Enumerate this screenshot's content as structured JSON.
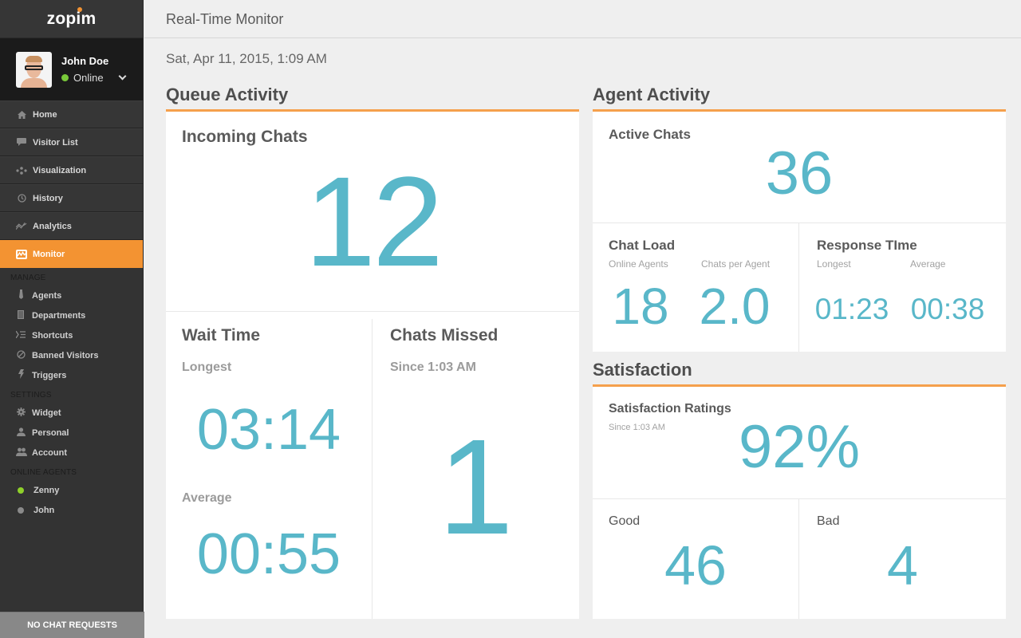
{
  "app": {
    "logo": "zopim",
    "page_title": "Real-Time Monitor",
    "datetime": "Sat, Apr 11, 2015, 1:09 AM"
  },
  "user": {
    "name": "John Doe",
    "status": "Online"
  },
  "nav": {
    "items": [
      {
        "label": "Home",
        "icon": "home-icon"
      },
      {
        "label": "Visitor List",
        "icon": "chat-bubble-icon"
      },
      {
        "label": "Visualization",
        "icon": "visualization-icon"
      },
      {
        "label": "History",
        "icon": "clock-icon"
      },
      {
        "label": "Analytics",
        "icon": "analytics-icon"
      },
      {
        "label": "Monitor",
        "icon": "monitor-icon",
        "active": true
      }
    ],
    "manage_label": "MANAGE",
    "manage": [
      {
        "label": "Agents",
        "icon": "tie-icon"
      },
      {
        "label": "Departments",
        "icon": "building-icon"
      },
      {
        "label": "Shortcuts",
        "icon": "shortcuts-icon"
      },
      {
        "label": "Banned Visitors",
        "icon": "ban-icon"
      },
      {
        "label": "Triggers",
        "icon": "lightning-icon"
      }
    ],
    "settings_label": "SETTINGS",
    "settings": [
      {
        "label": "Widget",
        "icon": "gear-icon"
      },
      {
        "label": "Personal",
        "icon": "person-icon"
      },
      {
        "label": "Account",
        "icon": "people-icon"
      }
    ],
    "online_agents_label": "ONLINE AGENTS",
    "online_agents": [
      {
        "label": "Zenny",
        "status_color": "#8fd12a"
      },
      {
        "label": "John",
        "status_color": "#8a8a8a"
      }
    ],
    "footer": "NO CHAT REQUESTS"
  },
  "queue_activity": {
    "title": "Queue Activity",
    "incoming_chats": {
      "label": "Incoming Chats",
      "value": "12"
    },
    "wait_time": {
      "label": "Wait Time",
      "longest_label": "Longest",
      "longest_value": "03:14",
      "average_label": "Average",
      "average_value": "00:55"
    },
    "chats_missed": {
      "label": "Chats Missed",
      "since": "Since 1:03 AM",
      "value": "1"
    }
  },
  "agent_activity": {
    "title": "Agent Activity",
    "active_chats": {
      "label": "Active Chats",
      "value": "36"
    },
    "chat_load": {
      "label": "Chat Load",
      "online_agents_label": "Online Agents",
      "online_agents_value": "18",
      "chats_per_agent_label": "Chats per Agent",
      "chats_per_agent_value": "2.0"
    },
    "response_time": {
      "label": "Response TIme",
      "longest_label": "Longest",
      "longest_value": "01:23",
      "average_label": "Average",
      "average_value": "00:38"
    }
  },
  "satisfaction": {
    "title": "Satisfaction",
    "ratings": {
      "label": "Satisfaction Ratings",
      "since": "Since 1:03 AM",
      "value": "92%"
    },
    "good": {
      "label": "Good",
      "value": "46"
    },
    "bad": {
      "label": "Bad",
      "value": "4"
    }
  },
  "colors": {
    "accent": "#f39332",
    "metric": "#59b7c9",
    "online": "#79c93a"
  }
}
